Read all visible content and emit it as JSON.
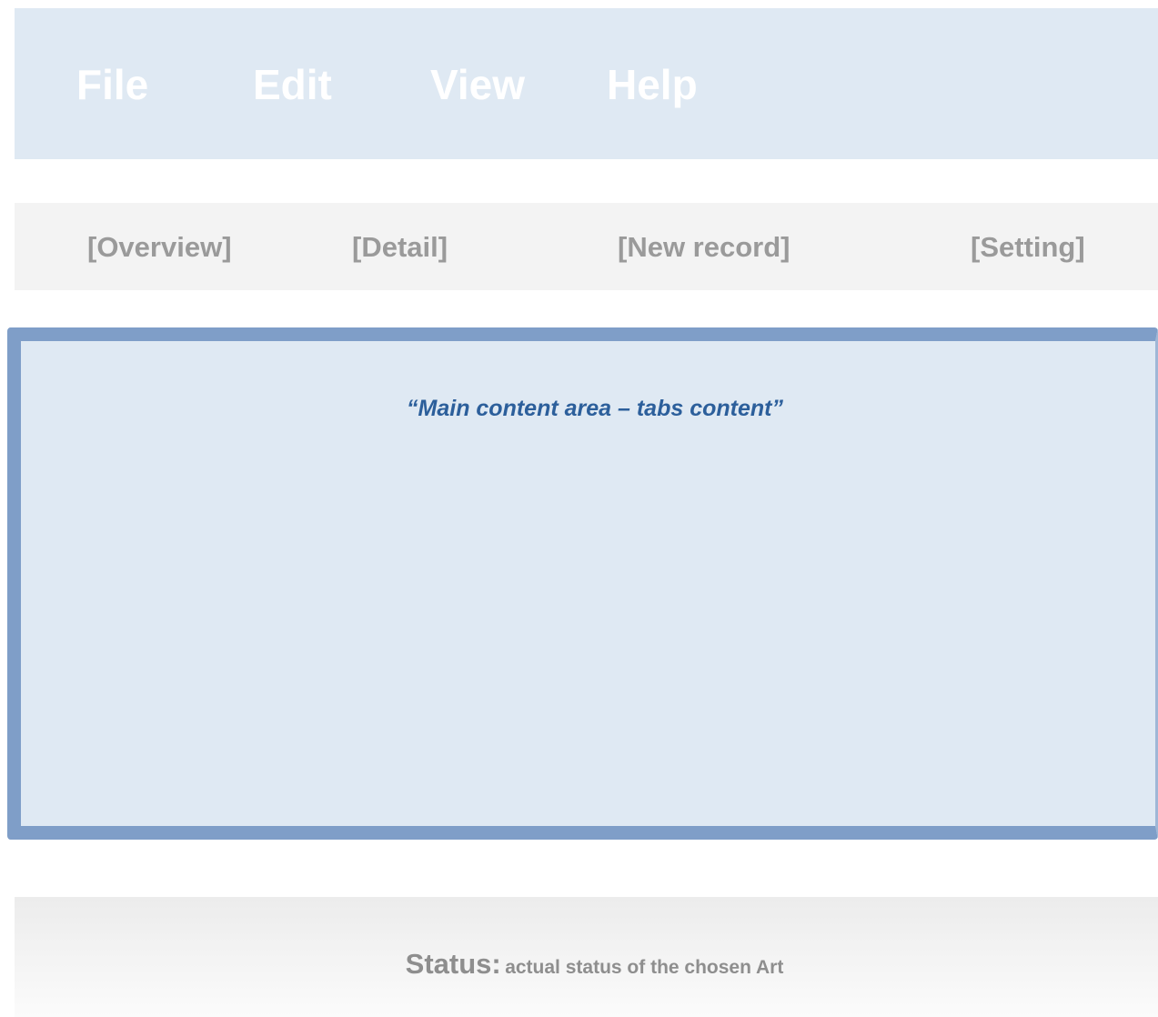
{
  "menubar": {
    "items": [
      "File",
      "Edit",
      "View",
      "Help"
    ]
  },
  "tabs": [
    "[Overview]",
    "[Detail]",
    "[New record]",
    "[Setting]"
  ],
  "content": {
    "placeholder": "“Main content area – tabs content”"
  },
  "statusbar": {
    "label": "Status:",
    "value": "actual status of the chosen Art"
  },
  "colors": {
    "menubar_bg": "#dfe9f3",
    "tabbar_bg": "#f3f3f3",
    "content_border": "#7f9ec8",
    "content_text": "#2c5f9b",
    "muted_text": "#9a9a9a"
  }
}
